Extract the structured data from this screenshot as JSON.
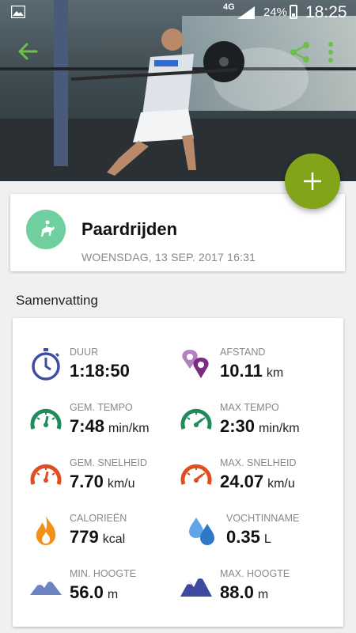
{
  "status_bar": {
    "network": "4G",
    "battery": "24%",
    "time": "18:25"
  },
  "activity": {
    "name": "Paardrijden",
    "date": "WOENSDAG, 13 SEP. 2017 16:31"
  },
  "summary": {
    "title": "Samenvatting",
    "stats": [
      {
        "label": "DUUR",
        "value": "1:18:50",
        "unit": ""
      },
      {
        "label": "AFSTAND",
        "value": "10.11",
        "unit": "km"
      },
      {
        "label": "GEM. TEMPO",
        "value": "7:48",
        "unit": "min/km"
      },
      {
        "label": "MAX TEMPO",
        "value": "2:30",
        "unit": "min/km"
      },
      {
        "label": "GEM. SNELHEID",
        "value": "7.70",
        "unit": "km/u"
      },
      {
        "label": "MAX. SNELHEID",
        "value": "24.07",
        "unit": "km/u"
      },
      {
        "label": "CALORIEËN",
        "value": "779",
        "unit": "kcal"
      },
      {
        "label": "VOCHTINNAME",
        "value": "0.35",
        "unit": "L"
      },
      {
        "label": "MIN. HOOGTE",
        "value": "56.0",
        "unit": "m"
      },
      {
        "label": "MAX. HOOGTE",
        "value": "88.0",
        "unit": "m"
      }
    ]
  },
  "icons": {
    "back": "arrow-left-icon",
    "share": "share-icon",
    "more": "more-vert-icon",
    "fab": "plus-icon",
    "activity": "horse-riding-icon"
  },
  "colors": {
    "accent": "#82a41b",
    "activity_circle": "#6fcf9f",
    "duration": "#3b4fa0",
    "distance": "#8b3d8f",
    "tempo": "#1f8a5a",
    "speed": "#e04d1f",
    "calories": "#f39018",
    "water": "#3a8ee0",
    "altitude": "#3e4aa0"
  }
}
